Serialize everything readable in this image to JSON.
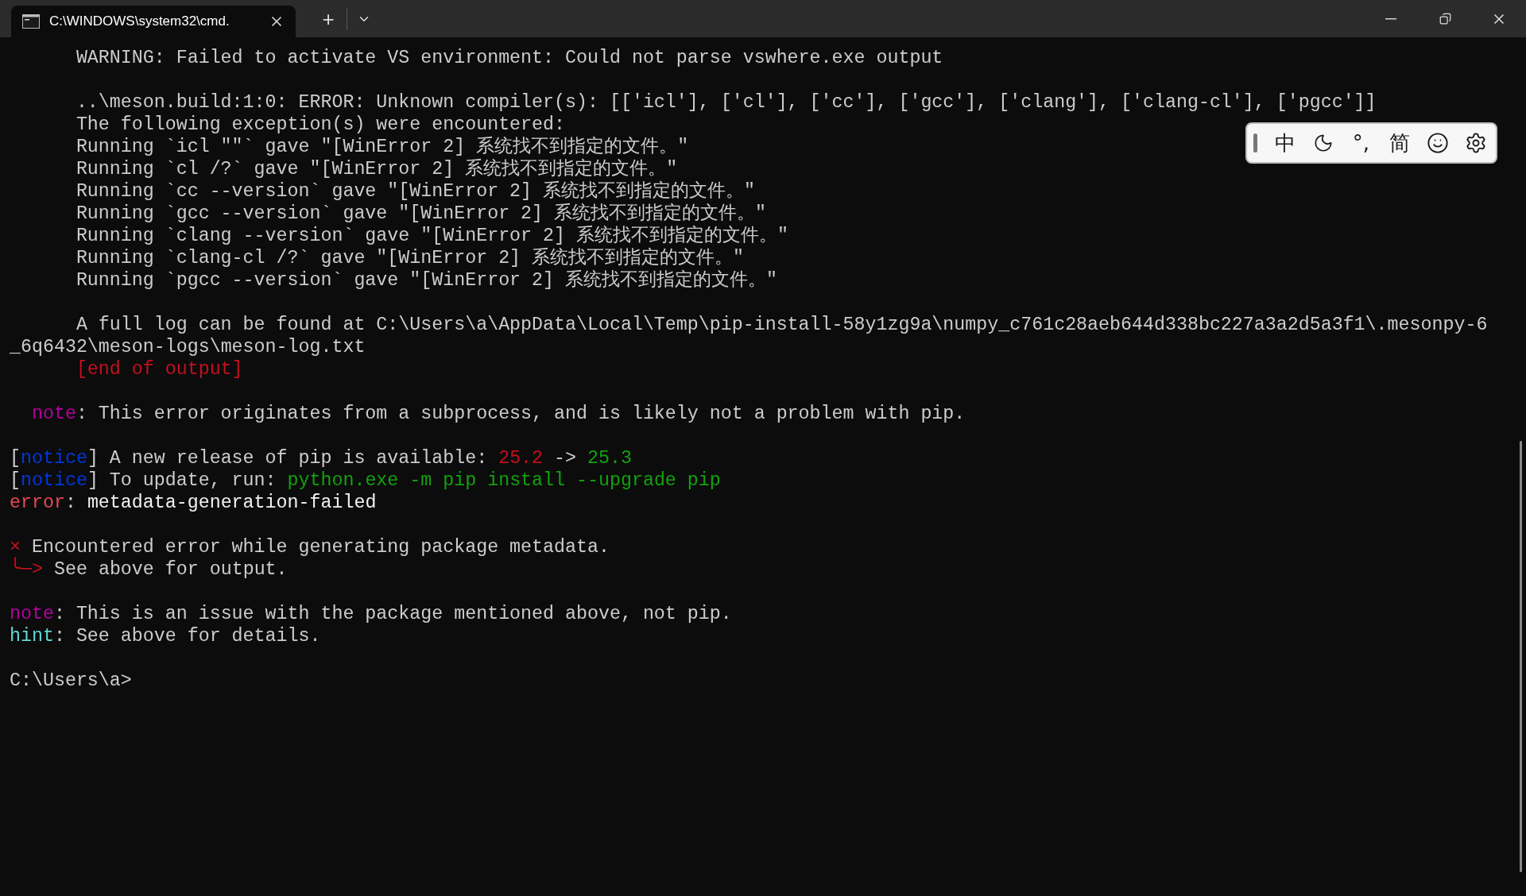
{
  "tab": {
    "title": "C:\\WINDOWS\\system32\\cmd.",
    "selected": true
  },
  "new_tab": "+",
  "ime_toolbar": {
    "buttons": [
      {
        "kind": "text",
        "label": "中"
      },
      {
        "kind": "moon"
      },
      {
        "kind": "text",
        "label": "°,"
      },
      {
        "kind": "text",
        "label": "简"
      },
      {
        "kind": "smiley"
      },
      {
        "kind": "gear"
      }
    ]
  },
  "blocks": [
    {
      "lines": [
        {
          "kind": "indented",
          "segments": [
            {
              "kind": "plain",
              "text": "WARNING: Failed to activate VS environment: Could not parse vswhere.exe output"
            }
          ]
        }
      ]
    },
    {
      "lines": [
        {
          "kind": "indented",
          "segments": [
            {
              "kind": "plain",
              "text": "..\\meson.build:1:0: ERROR: Unknown compiler(s): [['icl'], ['cl'], ['cc'], ['gcc'], ['clang'], ['clang-cl'], ['pgcc']]"
            }
          ]
        },
        {
          "kind": "indented",
          "segments": [
            {
              "kind": "plain",
              "text": "The following exception(s) were encountered:"
            }
          ]
        },
        {
          "kind": "indented",
          "segments": [
            {
              "kind": "plain",
              "text": "Running `icl \"\"` gave \"[WinError 2] 系统找不到指定的文件。\""
            }
          ]
        },
        {
          "kind": "indented",
          "segments": [
            {
              "kind": "plain",
              "text": "Running `cl /?` gave \"[WinError 2] 系统找不到指定的文件。\""
            }
          ]
        },
        {
          "kind": "indented",
          "segments": [
            {
              "kind": "plain",
              "text": "Running `cc --version` gave \"[WinError 2] 系统找不到指定的文件。\""
            }
          ]
        },
        {
          "kind": "indented",
          "segments": [
            {
              "kind": "plain",
              "text": "Running `gcc --version` gave \"[WinError 2] 系统找不到指定的文件。\""
            }
          ]
        },
        {
          "kind": "indented",
          "segments": [
            {
              "kind": "plain",
              "text": "Running `clang --version` gave \"[WinError 2] 系统找不到指定的文件。\""
            }
          ]
        },
        {
          "kind": "indented",
          "segments": [
            {
              "kind": "plain",
              "text": "Running `clang-cl /?` gave \"[WinError 2] 系统找不到指定的文件。\""
            }
          ]
        },
        {
          "kind": "indented",
          "segments": [
            {
              "kind": "plain",
              "text": "Running `pgcc --version` gave \"[WinError 2] 系统找不到指定的文件。\""
            }
          ]
        }
      ]
    },
    {
      "lines": [
        {
          "kind": "indented",
          "segments": [
            {
              "kind": "plain",
              "text": "A full log can be found at C:\\Users\\a\\AppData\\Local\\Temp\\pip-install-58y1zg9a\\numpy_c761c28aeb644d338bc227a3a2d5a3f1\\.mesonpy-6"
            }
          ]
        },
        {
          "kind": "flush",
          "segments": [
            {
              "kind": "plain",
              "text": "_6q6432\\meson-logs\\meson-log.txt"
            }
          ]
        },
        {
          "kind": "indented",
          "segments": [
            {
              "kind": "red",
              "text": "[end of output]"
            }
          ]
        }
      ]
    },
    {
      "lines": [
        {
          "kind": "half-indented",
          "segments": [
            {
              "kind": "note",
              "text": "note"
            },
            {
              "kind": "plain",
              "text": ": This error originates from a subprocess, and is likely not a problem with pip."
            }
          ]
        }
      ]
    },
    {
      "lines": [
        {
          "kind": "flush",
          "segments": [
            {
              "kind": "plain",
              "text": "["
            },
            {
              "kind": "notice",
              "text": "notice"
            },
            {
              "kind": "plain",
              "text": "] A new release of pip is available: "
            },
            {
              "kind": "red",
              "text": "25.2"
            },
            {
              "kind": "plain",
              "text": " -> "
            },
            {
              "kind": "green",
              "text": "25.3"
            }
          ]
        },
        {
          "kind": "flush",
          "segments": [
            {
              "kind": "plain",
              "text": "["
            },
            {
              "kind": "notice",
              "text": "notice"
            },
            {
              "kind": "plain",
              "text": "] To update, run: "
            },
            {
              "kind": "green",
              "text": "python.exe -m pip install --upgrade pip"
            }
          ]
        },
        {
          "kind": "flush",
          "segments": [
            {
              "kind": "error",
              "text": "error"
            },
            {
              "kind": "plain",
              "text": ": "
            },
            {
              "kind": "bright",
              "text": "metadata-generation-failed"
            }
          ]
        }
      ]
    },
    {
      "lines": [
        {
          "kind": "flush",
          "segments": [
            {
              "kind": "red",
              "text": "×"
            },
            {
              "kind": "plain",
              "text": " Encountered error while generating package metadata."
            }
          ]
        },
        {
          "kind": "flush",
          "segments": [
            {
              "kind": "red",
              "text": "╰─>"
            },
            {
              "kind": "plain",
              "text": " See above for output."
            }
          ]
        }
      ]
    },
    {
      "lines": [
        {
          "kind": "flush",
          "segments": [
            {
              "kind": "note",
              "text": "note"
            },
            {
              "kind": "plain",
              "text": ": This is an issue with the package mentioned above, not pip."
            }
          ]
        },
        {
          "kind": "flush",
          "segments": [
            {
              "kind": "hint",
              "text": "hint"
            },
            {
              "kind": "plain",
              "text": ": See above for details."
            }
          ]
        }
      ]
    },
    {
      "lines": [
        {
          "kind": "flush",
          "segments": [
            {
              "kind": "plain",
              "text": "C:\\Users\\a>"
            }
          ]
        }
      ]
    }
  ]
}
